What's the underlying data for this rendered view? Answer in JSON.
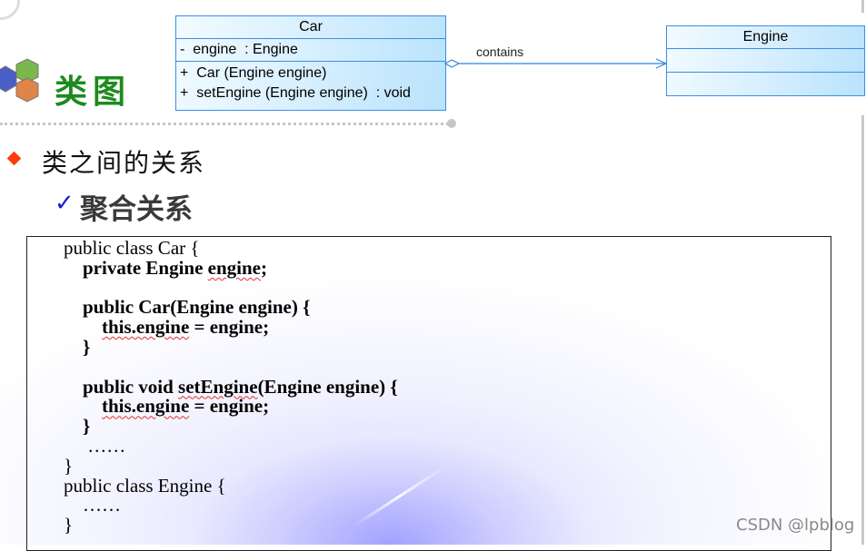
{
  "slide": {
    "title": "类图",
    "heading": "类之间的关系",
    "subheading": "聚合关系",
    "icons": {
      "logo": "hexagon-cluster-icon",
      "bullet": "diamond-bullet-icon",
      "check": "checkmark-icon"
    },
    "colors": {
      "title_green": "#1e8a1e",
      "bullet_red": "#ff3b0a",
      "check_blue": "#1a1ad6",
      "uml_border": "#3a8ee6",
      "uml_fill": "#d7efff"
    }
  },
  "uml": {
    "car": {
      "name": "Car",
      "attributes": [
        "-  engine  : Engine"
      ],
      "operations": [
        "+  Car (Engine engine)",
        "+  setEngine (Engine engine)  : void"
      ]
    },
    "engine": {
      "name": "Engine",
      "attributes": [],
      "operations": []
    },
    "association": {
      "label": "contains",
      "type": "aggregation"
    }
  },
  "code": {
    "l1": "public class Car {",
    "l2a": "private Engine ",
    "l2b": "engine",
    "l2c": ";",
    "l4": "public Car(Engine engine) {",
    "l5a": "this.engine",
    "l5b": " = engine;",
    "l6": "}",
    "l8a": "public void ",
    "l8b": "setEngine",
    "l8c": "(Engine engine) {",
    "l9a": "this.engine",
    "l9b": " = engine;",
    "l10": "}",
    "l11": "……",
    "l12": "}",
    "l13": "public class Engine {",
    "l14": "……",
    "l15": "}"
  },
  "watermark": "CSDN @lpblog"
}
